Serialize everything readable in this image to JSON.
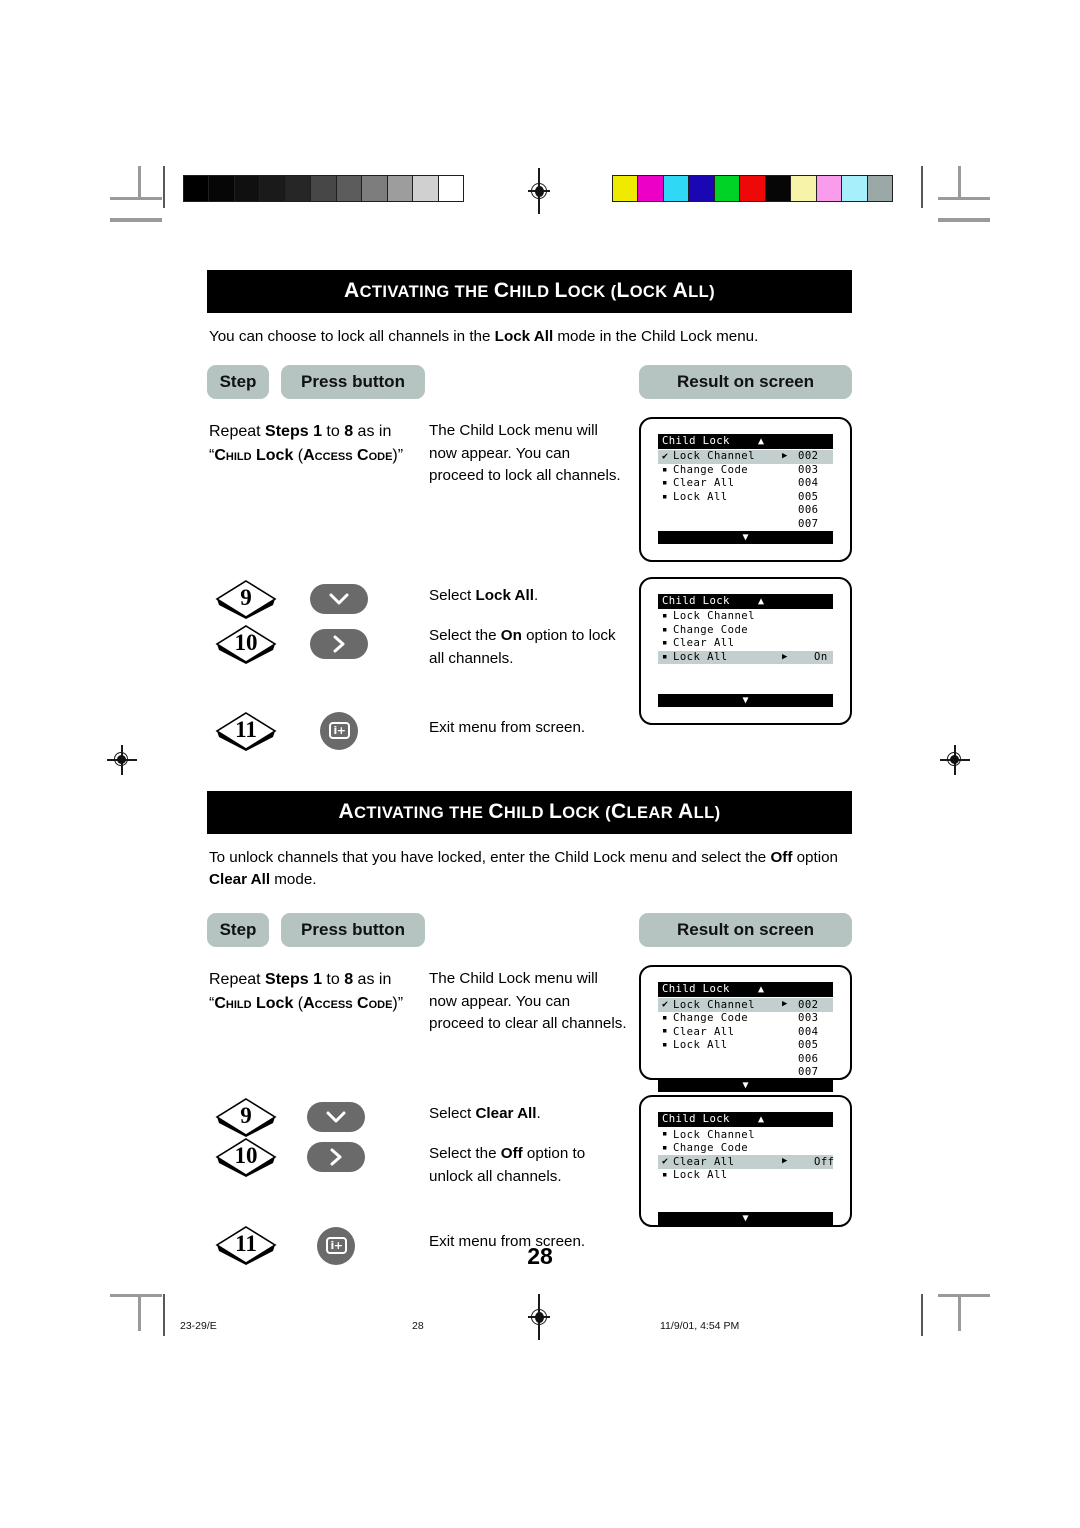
{
  "document": {
    "page_number": "28",
    "footer_left": "23-29/E",
    "footer_center": "28",
    "footer_right": "11/9/01, 4:54 PM"
  },
  "calibration": {
    "grayscale": [
      "#000000",
      "#060606",
      "#101010",
      "#1a1a1a",
      "#262626",
      "#474747",
      "#5c5c5c",
      "#7d7d7d",
      "#9d9d9d",
      "#d0d0d0",
      "#ffffff"
    ],
    "color": [
      "#eeea00",
      "#ec00c8",
      "#2fd8f4",
      "#1b06b4",
      "#00d226",
      "#ee0808",
      "#060606",
      "#f7f3a8",
      "#f99cec",
      "#a7f0fb",
      "#9aa8a8"
    ]
  },
  "sections": [
    {
      "title_parts": [
        {
          "text": "A",
          "size": "cap"
        },
        {
          "text": "CTIVATING THE ",
          "size": "sm"
        },
        {
          "text": "C",
          "size": "cap"
        },
        {
          "text": "HILD ",
          "size": "sm"
        },
        {
          "text": "L",
          "size": "cap"
        },
        {
          "text": "OCK (",
          "size": "sm"
        },
        {
          "text": "L",
          "size": "cap"
        },
        {
          "text": "OCK ",
          "size": "sm"
        },
        {
          "text": "A",
          "size": "cap"
        },
        {
          "text": "LL)",
          "size": "sm"
        }
      ],
      "title_plain": "ACTIVATING THE CHILD LOCK (LOCK ALL)",
      "intro": {
        "before": "You can choose to lock all channels in the ",
        "bold": "Lock All",
        "after": " mode in the Child Lock menu."
      },
      "headers": {
        "step": "Step",
        "press_button": "Press button",
        "result": "Result on screen"
      },
      "repeat_row": {
        "instruction_html": "Repeat <b>Steps 1</b> to <b>8</b> as in “<span class=\"sc\">Child</span> <b>Lock</b> (<span class=\"sc\">Access Code</span>)”",
        "result": "The Child Lock menu will now appear. You can proceed to lock all channels."
      },
      "steps": [
        {
          "number": "9",
          "button": "down-arrow",
          "result_before": "Select ",
          "result_bold": "Lock All",
          "result_after": "."
        },
        {
          "number": "10",
          "button": "right-arrow",
          "result_before": "Select the ",
          "result_bold": "On",
          "result_after": " option to lock all channels."
        },
        {
          "number": "11",
          "button": "exit-menu",
          "result_before": "Exit menu from screen.",
          "result_bold": "",
          "result_after": ""
        }
      ],
      "screens": [
        {
          "title": "Child Lock",
          "up_arrow": "▲",
          "down_arrow": "▼",
          "items": [
            {
              "marker": "check",
              "label": "Lock Channel",
              "arrow": true,
              "value": "",
              "selected": true
            },
            {
              "marker": "square",
              "label": "Change Code",
              "arrow": false,
              "value": "",
              "selected": false
            },
            {
              "marker": "square",
              "label": "Clear All",
              "arrow": false,
              "value": "",
              "selected": false
            },
            {
              "marker": "square",
              "label": "Lock All",
              "arrow": false,
              "value": "",
              "selected": false
            }
          ],
          "channels": [
            "002",
            "003",
            "004",
            "005",
            "006",
            "007"
          ]
        },
        {
          "title": "Child Lock",
          "up_arrow": "▲",
          "down_arrow": "▼",
          "items": [
            {
              "marker": "square",
              "label": "Lock Channel",
              "arrow": false,
              "value": "",
              "selected": false
            },
            {
              "marker": "square",
              "label": "Change Code",
              "arrow": false,
              "value": "",
              "selected": false
            },
            {
              "marker": "square",
              "label": "Clear All",
              "arrow": false,
              "value": "",
              "selected": false
            },
            {
              "marker": "square",
              "label": "Lock All",
              "arrow": true,
              "value": "On",
              "selected": true
            }
          ],
          "channels": []
        }
      ]
    },
    {
      "title_parts": [
        {
          "text": "A",
          "size": "cap"
        },
        {
          "text": "CTIVATING THE ",
          "size": "sm"
        },
        {
          "text": "C",
          "size": "cap"
        },
        {
          "text": "HILD ",
          "size": "sm"
        },
        {
          "text": "L",
          "size": "cap"
        },
        {
          "text": "OCK (",
          "size": "sm"
        },
        {
          "text": "C",
          "size": "cap"
        },
        {
          "text": "LEAR ",
          "size": "sm"
        },
        {
          "text": "A",
          "size": "cap"
        },
        {
          "text": "LL)",
          "size": "sm"
        }
      ],
      "title_plain": "ACTIVATING THE CHILD LOCK (CLEAR ALL)",
      "intro": {
        "before": "To unlock channels that you have locked, enter the Child Lock menu and select the ",
        "bold": "Off",
        "after": " option <b>Clear All</b> mode."
      },
      "headers": {
        "step": "Step",
        "press_button": "Press button",
        "result": "Result on screen"
      },
      "repeat_row": {
        "instruction_html": "Repeat <b>Steps 1</b> to <b>8</b> as in “<span class=\"sc\">Child</span> <b>Lock</b> (<span class=\"sc\">Access Code</span>)”",
        "result": "The Child Lock menu will now appear. You can proceed to clear all channels."
      },
      "steps": [
        {
          "number": "9",
          "button": "down-arrow",
          "result_before": "Select ",
          "result_bold": "Clear All",
          "result_after": "."
        },
        {
          "number": "10",
          "button": "right-arrow",
          "result_before": "Select the ",
          "result_bold": "Off",
          "result_after": " option to unlock all channels."
        },
        {
          "number": "11",
          "button": "exit-menu",
          "result_before": "Exit menu from screen.",
          "result_bold": "",
          "result_after": ""
        }
      ],
      "screens": [
        {
          "title": "Child Lock",
          "up_arrow": "▲",
          "down_arrow": "▼",
          "items": [
            {
              "marker": "check",
              "label": "Lock Channel",
              "arrow": true,
              "value": "",
              "selected": true
            },
            {
              "marker": "square",
              "label": "Change Code",
              "arrow": false,
              "value": "",
              "selected": false
            },
            {
              "marker": "square",
              "label": "Clear All",
              "arrow": false,
              "value": "",
              "selected": false
            },
            {
              "marker": "square",
              "label": "Lock All",
              "arrow": false,
              "value": "",
              "selected": false
            }
          ],
          "channels": [
            "002",
            "003",
            "004",
            "005",
            "006",
            "007"
          ]
        },
        {
          "title": "Child Lock",
          "up_arrow": "▲",
          "down_arrow": "▼",
          "items": [
            {
              "marker": "square",
              "label": "Lock Channel",
              "arrow": false,
              "value": "",
              "selected": false
            },
            {
              "marker": "square",
              "label": "Change Code",
              "arrow": false,
              "value": "",
              "selected": false
            },
            {
              "marker": "check",
              "label": "Clear All",
              "arrow": true,
              "value": "Off",
              "selected": true
            },
            {
              "marker": "square",
              "label": "Lock All",
              "arrow": false,
              "value": "",
              "selected": false
            }
          ],
          "channels": []
        }
      ]
    }
  ]
}
